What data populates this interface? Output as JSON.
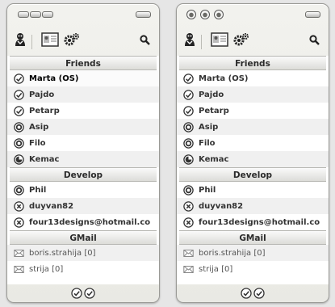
{
  "groups": [
    {
      "name": "Friends"
    },
    {
      "name": "Develop"
    },
    {
      "name": "GMail"
    }
  ],
  "friends": [
    {
      "name": "Marta (OS)",
      "status": "online-check"
    },
    {
      "name": "Pajdo",
      "status": "online-check"
    },
    {
      "name": "Petarp",
      "status": "online-check"
    },
    {
      "name": "Asip",
      "status": "away-ring"
    },
    {
      "name": "Filo",
      "status": "away-ring"
    },
    {
      "name": "Kemac",
      "status": "partial-moon"
    }
  ],
  "develop": [
    {
      "name": "Phil",
      "status": "away-ring"
    },
    {
      "name": "duyvan82",
      "status": "offline-x"
    },
    {
      "name": "four13designs@hotmail.co",
      "status": "offline-x"
    }
  ],
  "gmail": [
    {
      "name": "boris.strahija [0]",
      "status": "envelope"
    },
    {
      "name": "strija [0]",
      "status": "envelope"
    }
  ],
  "toolbar": {
    "icons": [
      "user-icon",
      "contact-card-icon",
      "settings-gears-icon",
      "search-icon"
    ]
  },
  "colors": {
    "window_bg": "#ecece8",
    "row_alt": "#f0f0f0",
    "header_bg": "#e4e4e0",
    "text": "#333333"
  }
}
